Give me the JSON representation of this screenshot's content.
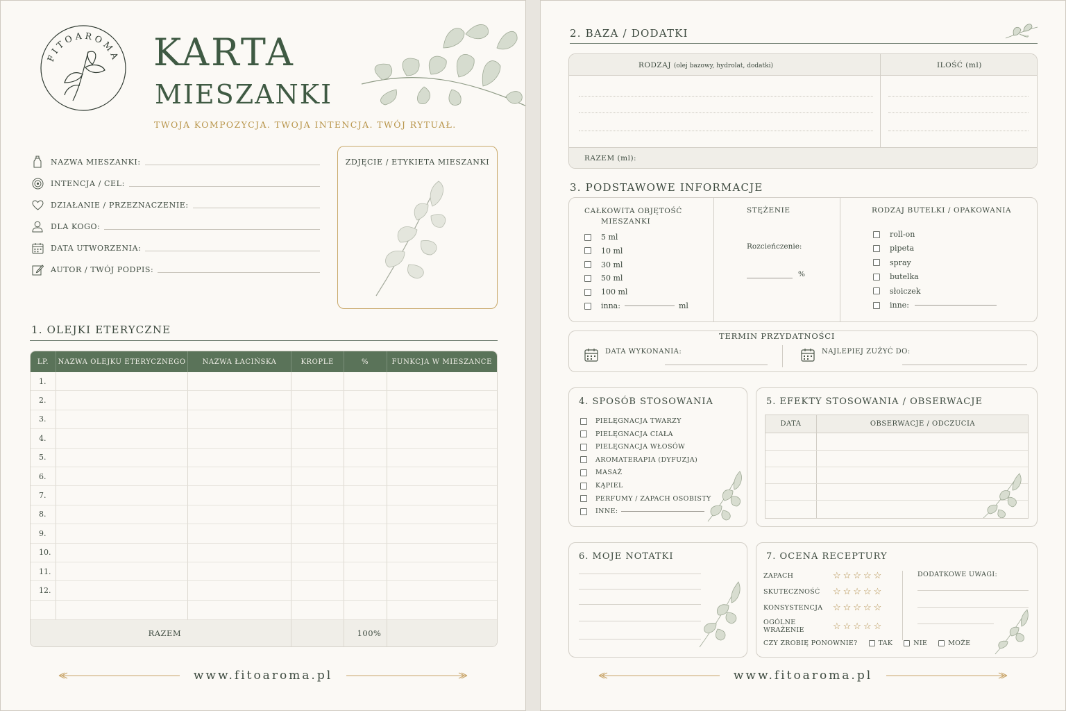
{
  "brand": {
    "logo_text": "FITOAROMA"
  },
  "header": {
    "title_line1": "KARTA",
    "title_line2": "MIESZANKI",
    "tagline": "TWOJA KOMPOZYCJA. TWOJA INTENCJA. TWÓJ RYTUAŁ."
  },
  "info_fields": [
    {
      "label": "NAZWA MIESZANKI:",
      "icon": "bottle-icon"
    },
    {
      "label": "INTENCJA / CEL:",
      "icon": "target-icon"
    },
    {
      "label": "DZIAŁANIE / PRZEZNACZENIE:",
      "icon": "heart-icon"
    },
    {
      "label": "DLA KOGO:",
      "icon": "person-icon"
    },
    {
      "label": "DATA UTWORZENIA:",
      "icon": "calendar-icon"
    },
    {
      "label": "AUTOR / TWÓJ PODPIS:",
      "icon": "pen-icon"
    }
  ],
  "photo_box": {
    "label": "ZDJĘCIE / ETYKIETA MIESZANKI"
  },
  "section1": {
    "title": "1.  OLEJKI ETERYCZNE",
    "columns": [
      "LP.",
      "NAZWA OLEJKU ETERYCZNEGO",
      "NAZWA ŁACIŃSKA",
      "KROPLE",
      "%",
      "FUNKCJA W MIESZANCE"
    ],
    "row_numbers": [
      "1.",
      "2.",
      "3.",
      "4.",
      "5.",
      "6.",
      "7.",
      "8.",
      "9.",
      "10.",
      "11.",
      "12."
    ],
    "total_label": "RAZEM",
    "total_percent": "100%"
  },
  "footer": {
    "url": "www.fitoaroma.pl"
  },
  "section2": {
    "title": "2.  BAZA / DODATKI",
    "col_type": "RODZAJ",
    "col_type_hint": "(olej bazowy, hydrolat, dodatki)",
    "col_qty": "ILOŚĆ (ml)",
    "total_label": "RAZEM (ml):"
  },
  "section3": {
    "title": "3.  PODSTAWOWE INFORMACJE",
    "volume_title_l1": "CAŁKOWITA OBJĘTOŚĆ",
    "volume_title_l2": "MIESZANKI",
    "volumes": [
      "5 ml",
      "10 ml",
      "30 ml",
      "50 ml",
      "100 ml",
      "inna:"
    ],
    "volume_unit": "ml",
    "concentration_title": "STĘŻENIE",
    "dilution_label": "Rozcieńczenie:",
    "percent_sign": "%",
    "bottle_title": "RODZAJ BUTELKI / OPAKOWANIA",
    "bottles": [
      "roll-on",
      "pipeta",
      "spray",
      "butelka",
      "słoiczek",
      "inne:"
    ]
  },
  "expiry": {
    "title": "TERMIN PRZYDATNOŚCI",
    "made_label": "DATA WYKONANIA:",
    "best_before_label": "NAJLEPIEJ ZUŻYĆ DO:"
  },
  "section4": {
    "title": "4.  SPOSÓB STOSOWANIA",
    "options": [
      "PIELĘGNACJA TWARZY",
      "PIELĘGNACJA CIAŁA",
      "PIELĘGNACJA WŁOSÓW",
      "AROMATERAPIA (DYFUZJA)",
      "MASAŻ",
      "KĄPIEL",
      "PERFUMY / ZAPACH OSOBISTY",
      "INNE:"
    ]
  },
  "section5": {
    "title": "5.  EFEKTY STOSOWANIA / OBSERWACJE",
    "col_date": "DATA",
    "col_obs": "OBSERWACJE / ODCZUCIA"
  },
  "section6": {
    "title": "6.  MOJE NOTATKI"
  },
  "section7": {
    "title": "7.  OCENA RECEPTURY",
    "criteria": [
      "ZAPACH",
      "SKUTECZNOŚĆ",
      "KONSYSTENCJA",
      "OGÓLNE WRAŻENIE"
    ],
    "stars": "☆☆☆☆☆",
    "extra_notes_label": "DODATKOWE UWAGI:",
    "again_label": "CZY ZROBIĘ PONOWNIE?",
    "again_options": [
      "TAK",
      "NIE",
      "MOŻE"
    ]
  },
  "colors": {
    "accent_green": "#5a7359",
    "title_green": "#3f5a43",
    "gold": "#b8954a",
    "paper": "#fbf9f5"
  }
}
